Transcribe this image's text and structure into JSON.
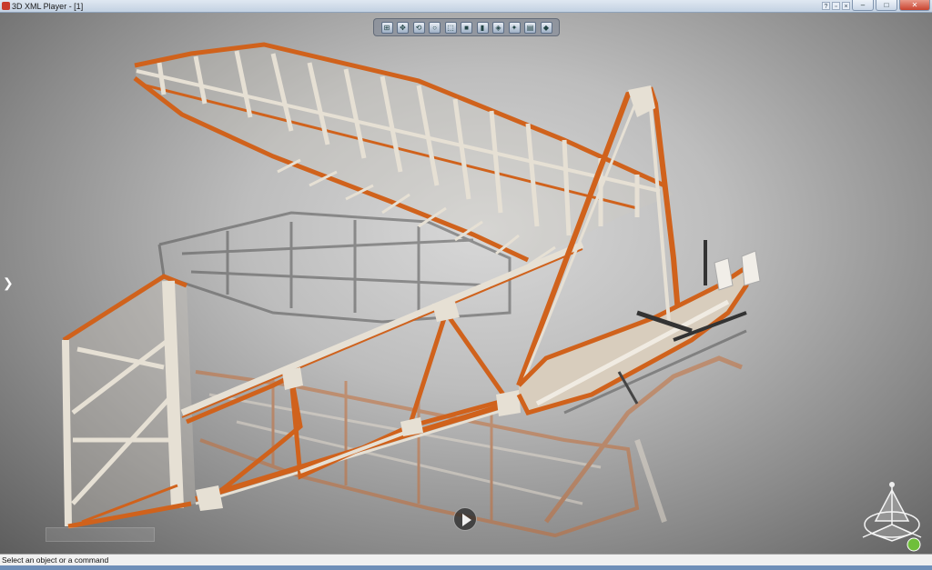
{
  "window": {
    "title": "3D XML Player - [1]",
    "controls": {
      "minimize": "–",
      "maximize": "□",
      "close": "✕"
    }
  },
  "toolbar": {
    "buttons": [
      {
        "name": "fit-all-icon",
        "glyph": "⊞"
      },
      {
        "name": "pan-icon",
        "glyph": "✥"
      },
      {
        "name": "rotate-icon",
        "glyph": "⟲"
      },
      {
        "name": "zoom-icon",
        "glyph": "○"
      },
      {
        "name": "normal-view-icon",
        "glyph": "⬚"
      },
      {
        "name": "view-mode-icon",
        "glyph": "■"
      },
      {
        "name": "shading-icon",
        "glyph": "▮"
      },
      {
        "name": "hide-show-icon",
        "glyph": "◈"
      },
      {
        "name": "measure-icon",
        "glyph": "✦"
      },
      {
        "name": "section-icon",
        "glyph": "▤"
      },
      {
        "name": "annotation-icon",
        "glyph": "◆"
      }
    ]
  },
  "viewport": {
    "left_toggle": "❯",
    "colors": {
      "frame_orange": "#d0621c",
      "frame_wood": "#e6e0d4",
      "shadow": "#5e5e5e"
    }
  },
  "status": {
    "text": "Select an object or a command"
  }
}
